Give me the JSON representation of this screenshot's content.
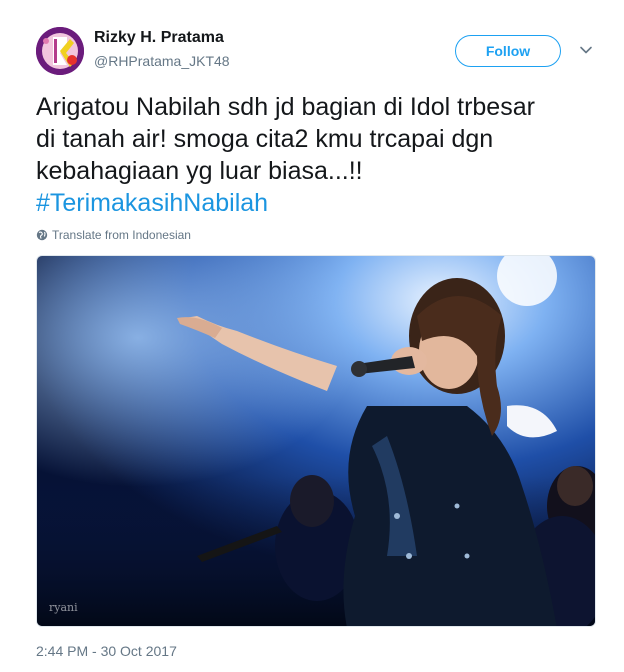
{
  "user": {
    "name": "Rizky H. Pratama",
    "handle": "@RHPratama_JKT48"
  },
  "follow_label": "Follow",
  "tweet": {
    "text_lines": [
      "Arigatou Nabilah sdh jd bagian di Idol trbesar",
      "di tanah air! smoga cita2 kmu trcapai dgn",
      "kebahagiaan yg luar biasa...!!"
    ],
    "hashtag": "#TerimakasihNabilah"
  },
  "translate_label": "Translate from Indonesian",
  "timestamp": "2:44 PM - 30 Oct 2017",
  "colors": {
    "accent": "#1da1f2",
    "hashtag": "#1b95e0",
    "secondary_text": "#657786"
  },
  "icons": {
    "caret": "chevron-down-icon",
    "globe": "globe-icon"
  }
}
